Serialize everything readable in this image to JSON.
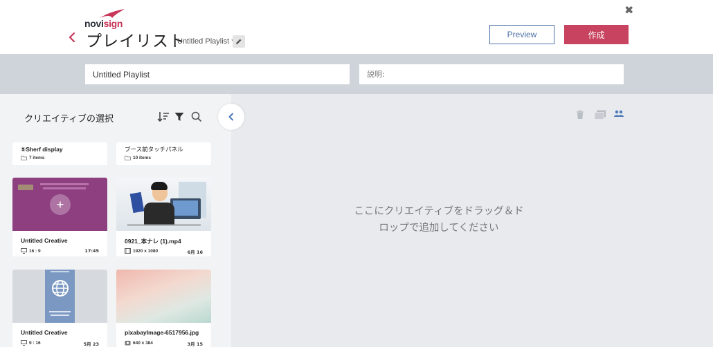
{
  "header": {
    "logo": {
      "part1": "novi",
      "part2": "sign"
    },
    "title": "プレイリスト",
    "subtitle": "Untitled Playlist *",
    "preview_label": "Preview",
    "create_label": "作成"
  },
  "form": {
    "name_value": "Untitled Playlist",
    "description_placeholder": "説明:"
  },
  "left_panel": {
    "title": "クリエイティブの選択",
    "folders": [
      {
        "name": "⑤Sherf display",
        "count": "7 items"
      },
      {
        "name": "ブース前タッチパネル",
        "count": "10 items"
      }
    ],
    "creatives": [
      {
        "name": "Untitled Creative",
        "meta": "16 : 9",
        "date": "17:45"
      },
      {
        "name": "0921_本ナレ (1).mp4",
        "meta": "1920 x 1080",
        "date": "6月 16"
      },
      {
        "name": "Untitled Creative",
        "meta": "9 : 16",
        "date": "5月 23"
      },
      {
        "name": "pixabayImage-6517956.jpg",
        "meta": "640 x 384",
        "date": "3月 15"
      }
    ]
  },
  "drop_zone": {
    "line1": "ここにクリエイティブをドラッグ＆ド",
    "line2": "ロップで追加してください"
  },
  "colors": {
    "accent": "#c8435f",
    "link_blue": "#4a6fa5",
    "purple_thumb": "#8e3f80"
  }
}
